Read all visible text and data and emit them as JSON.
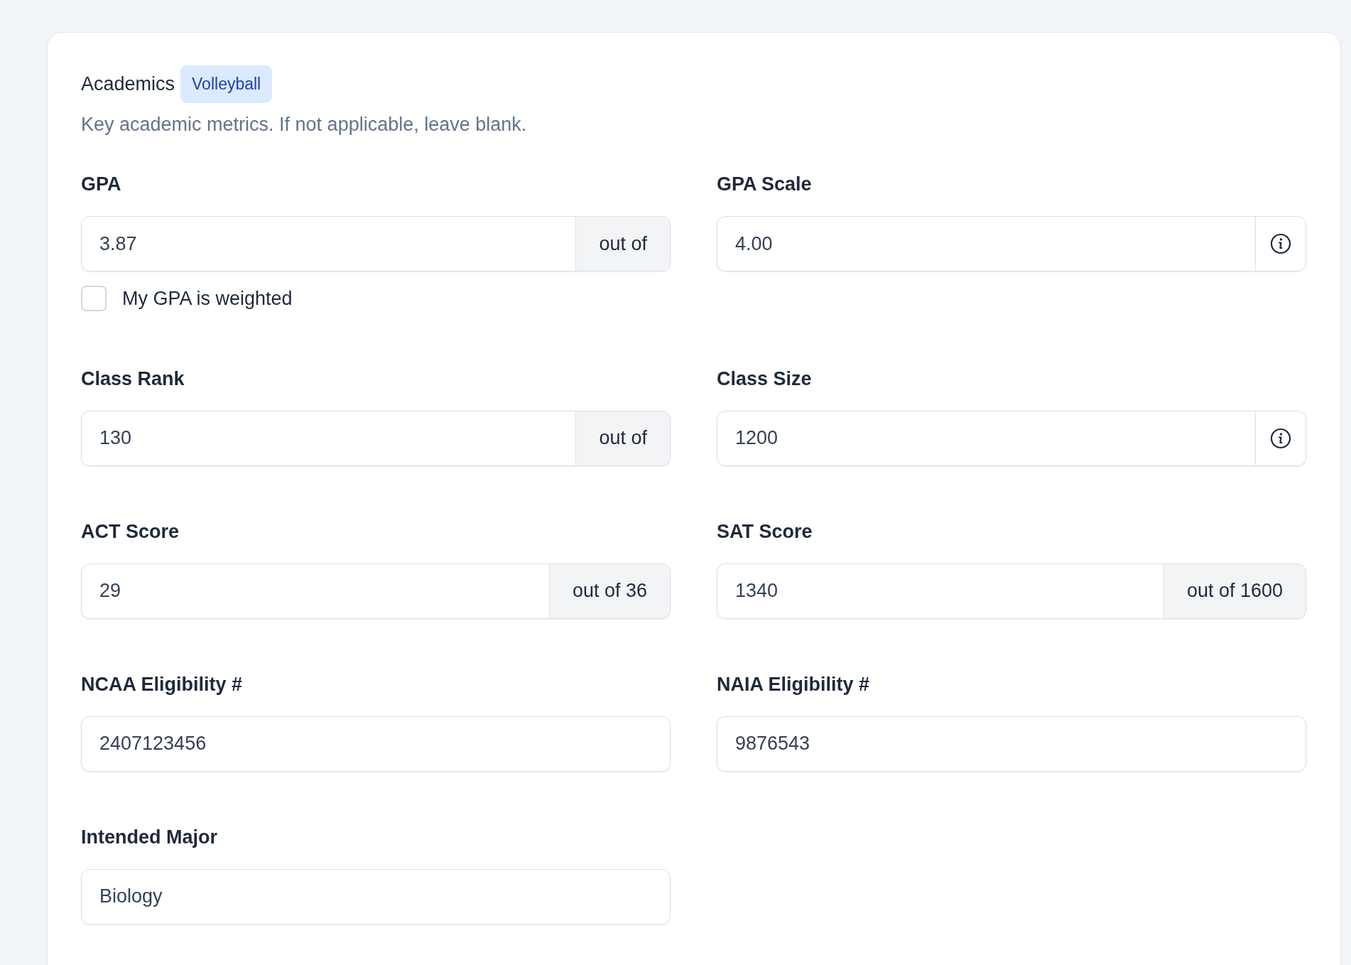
{
  "section": {
    "title": "Academics",
    "badge": "Volleyball",
    "description": "Key academic metrics. If not applicable, leave blank."
  },
  "fields": [
    {
      "label": "GPA",
      "value": "3.87",
      "kind": "suffix",
      "suffix": "out of",
      "checkbox": {
        "label": "My GPA is weighted",
        "checked": false
      }
    },
    {
      "label": "GPA Scale",
      "value": "4.00",
      "kind": "info"
    },
    {
      "label": "Class Rank",
      "value": "130",
      "kind": "suffix",
      "suffix": "out of"
    },
    {
      "label": "Class Size",
      "value": "1200",
      "kind": "info"
    },
    {
      "label": "ACT Score",
      "value": "29",
      "kind": "suffix",
      "suffix": "out of 36"
    },
    {
      "label": "SAT Score",
      "value": "1340",
      "kind": "suffix",
      "suffix": "out of 1600"
    },
    {
      "label": "NCAA Eligibility #",
      "value": "2407123456",
      "kind": "plain"
    },
    {
      "label": "NAIA Eligibility #",
      "value": "9876543",
      "kind": "plain"
    },
    {
      "label": "Intended Major",
      "value": "Biology",
      "kind": "plain"
    }
  ]
}
